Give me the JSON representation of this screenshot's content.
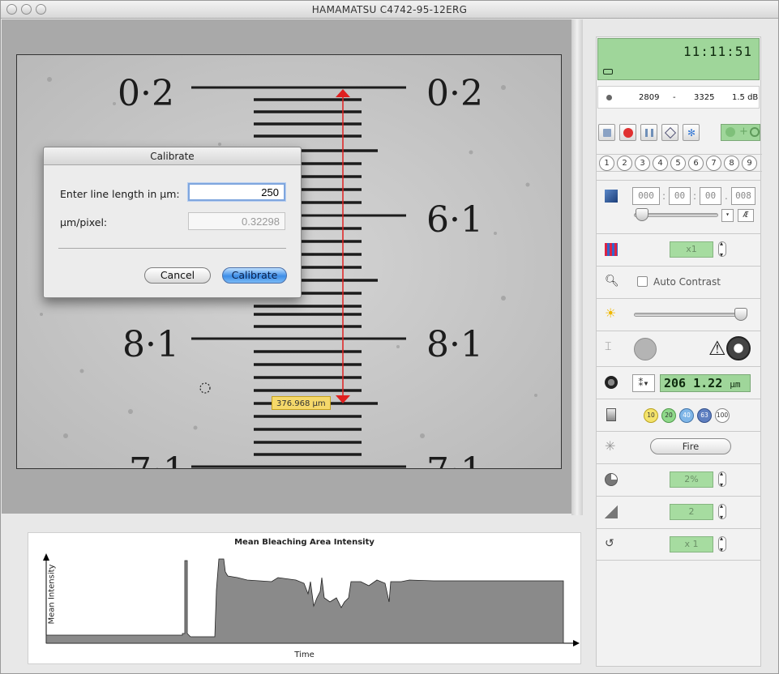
{
  "window": {
    "title": "HAMAMATSU C4742-95-12ERG"
  },
  "dialog": {
    "title": "Calibrate",
    "line_length_label": "Enter line length in µm:",
    "line_length_value": "250",
    "um_per_pixel_label": "µm/pixel:",
    "um_per_pixel_value": "0.32298",
    "cancel_label": "Cancel",
    "calibrate_label": "Calibrate"
  },
  "image": {
    "measurement_label": "376.968 µm",
    "scale_labels": [
      "0·2",
      "6·1",
      "8·1",
      "7·1"
    ]
  },
  "graph": {
    "title": "Mean Bleaching Area Intensity",
    "xlabel": "Time",
    "ylabel": "Mean Intensity"
  },
  "panel": {
    "clock": "11:11:51",
    "range_low": "2809",
    "range_sep": "-",
    "range_high": "3325",
    "gain": "1.5 dB",
    "position_numbers": [
      "1",
      "2",
      "3",
      "4",
      "5",
      "6",
      "7",
      "8",
      "9"
    ],
    "exposure_hours": "000",
    "exposure_min": "00",
    "exposure_sec": "00",
    "exposure_ms": "008",
    "exposure_sep": ":",
    "exposure_dot": ".",
    "binning": "x1",
    "auto_contrast_label": "Auto Contrast",
    "focus_value": "206 1.22",
    "focus_unit": "µm",
    "objectives": [
      "10",
      "20",
      "40",
      "63",
      "100"
    ],
    "fire_label": "Fire",
    "percent": "2%",
    "steps": "2",
    "repeat": "x 1"
  },
  "colors": {
    "lcd_green": "#9fd69a",
    "measure_line": "#e02020",
    "calibrate_blue": "#3d8ee8"
  }
}
